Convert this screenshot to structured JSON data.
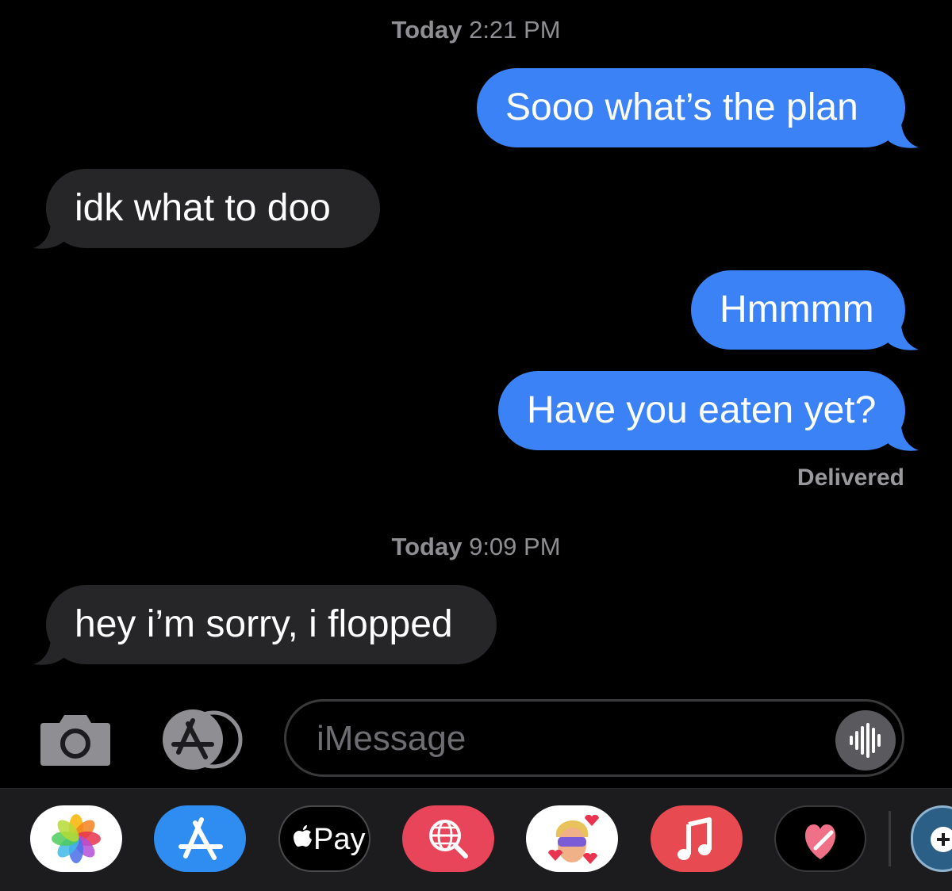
{
  "thread": {
    "timestamp1": {
      "day": "Today",
      "time": "2:21 PM"
    },
    "timestamp2": {
      "day": "Today",
      "time": "9:09 PM"
    },
    "messages": [
      {
        "direction": "outgoing",
        "text": "Sooo what’s the plan"
      },
      {
        "direction": "incoming",
        "text": "idk what to doo"
      },
      {
        "direction": "outgoing",
        "text": "Hmmmm"
      },
      {
        "direction": "outgoing",
        "text": "Have you eaten yet?"
      },
      {
        "direction": "incoming",
        "text": "hey i’m sorry, i flopped"
      }
    ],
    "delivery_status": "Delivered"
  },
  "input_bar": {
    "placeholder": "iMessage",
    "icons": [
      "camera-icon",
      "app-store-icon",
      "audio-waveform-icon"
    ]
  },
  "app_drawer": {
    "apps": [
      {
        "name": "Photos",
        "icon": "photos-icon"
      },
      {
        "name": "App Store",
        "icon": "app-store-icon"
      },
      {
        "name": "Apple Pay",
        "icon": "apple-logo-icon",
        "label": "Pay"
      },
      {
        "name": "Web Images",
        "icon": "globe-search-icon"
      },
      {
        "name": "Memoji Stickers",
        "icon": "memoji-icon"
      },
      {
        "name": "Music",
        "icon": "music-note-icon"
      },
      {
        "name": "Digital Touch",
        "icon": "heart-icon"
      },
      {
        "name": "More",
        "icon": "add-app-icon"
      }
    ]
  },
  "colors": {
    "background": "#000000",
    "outgoing_bubble": "#3b82f6",
    "incoming_bubble": "#262628",
    "timestamp_text": "#8e8e93",
    "drawer_background": "#1c1c1e"
  }
}
